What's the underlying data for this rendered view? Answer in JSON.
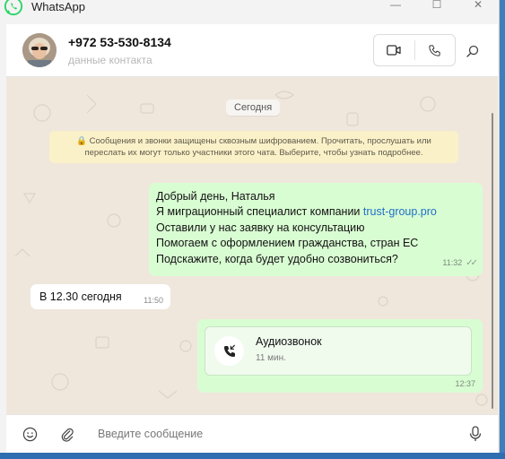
{
  "window": {
    "title": "WhatsApp",
    "controls": {
      "minimize": "—",
      "maximize": "☐",
      "close": "✕"
    }
  },
  "header": {
    "contact_name": "+972 53-530-8134",
    "contact_sub": "данные контакта",
    "icons": [
      "video-call-icon",
      "voice-call-icon",
      "search-icon"
    ]
  },
  "chat": {
    "date_chip": "Сегодня",
    "encryption_notice_1": "🔒 Сообщения и звонки защищены сквозным шифрованием. Прочитать, прослушать или",
    "encryption_notice_2": "переслать их могут только участники этого чата. Выберите, чтобы узнать подробнее.",
    "outgoing": {
      "line1": "Добрый день, Наталья",
      "line2_prefix": "Я  миграционный специалист компании ",
      "line2_link": "trust-group.pro",
      "line3": "Оставили у нас заявку на консультацию",
      "line4": "Помогаем с оформлением гражданства, стран ЕС",
      "line5": "Подскажите, когда будет удобно созвониться?",
      "time": "11:32",
      "ticks": "✓✓"
    },
    "incoming": {
      "text": "В 12.30 сегодня",
      "time": "11:50"
    },
    "call": {
      "title": "Аудиозвонок",
      "duration": "11 мин.",
      "time": "12:37"
    }
  },
  "composer": {
    "placeholder": "Введите сообщение",
    "icons": [
      "emoji-icon",
      "attach-icon",
      "microphone-icon"
    ]
  },
  "colors": {
    "outgoing_bubble": "#d9fdd3",
    "chat_background": "#efe7dc",
    "whatsapp_green": "#25d366",
    "link": "#1f6fc5"
  }
}
